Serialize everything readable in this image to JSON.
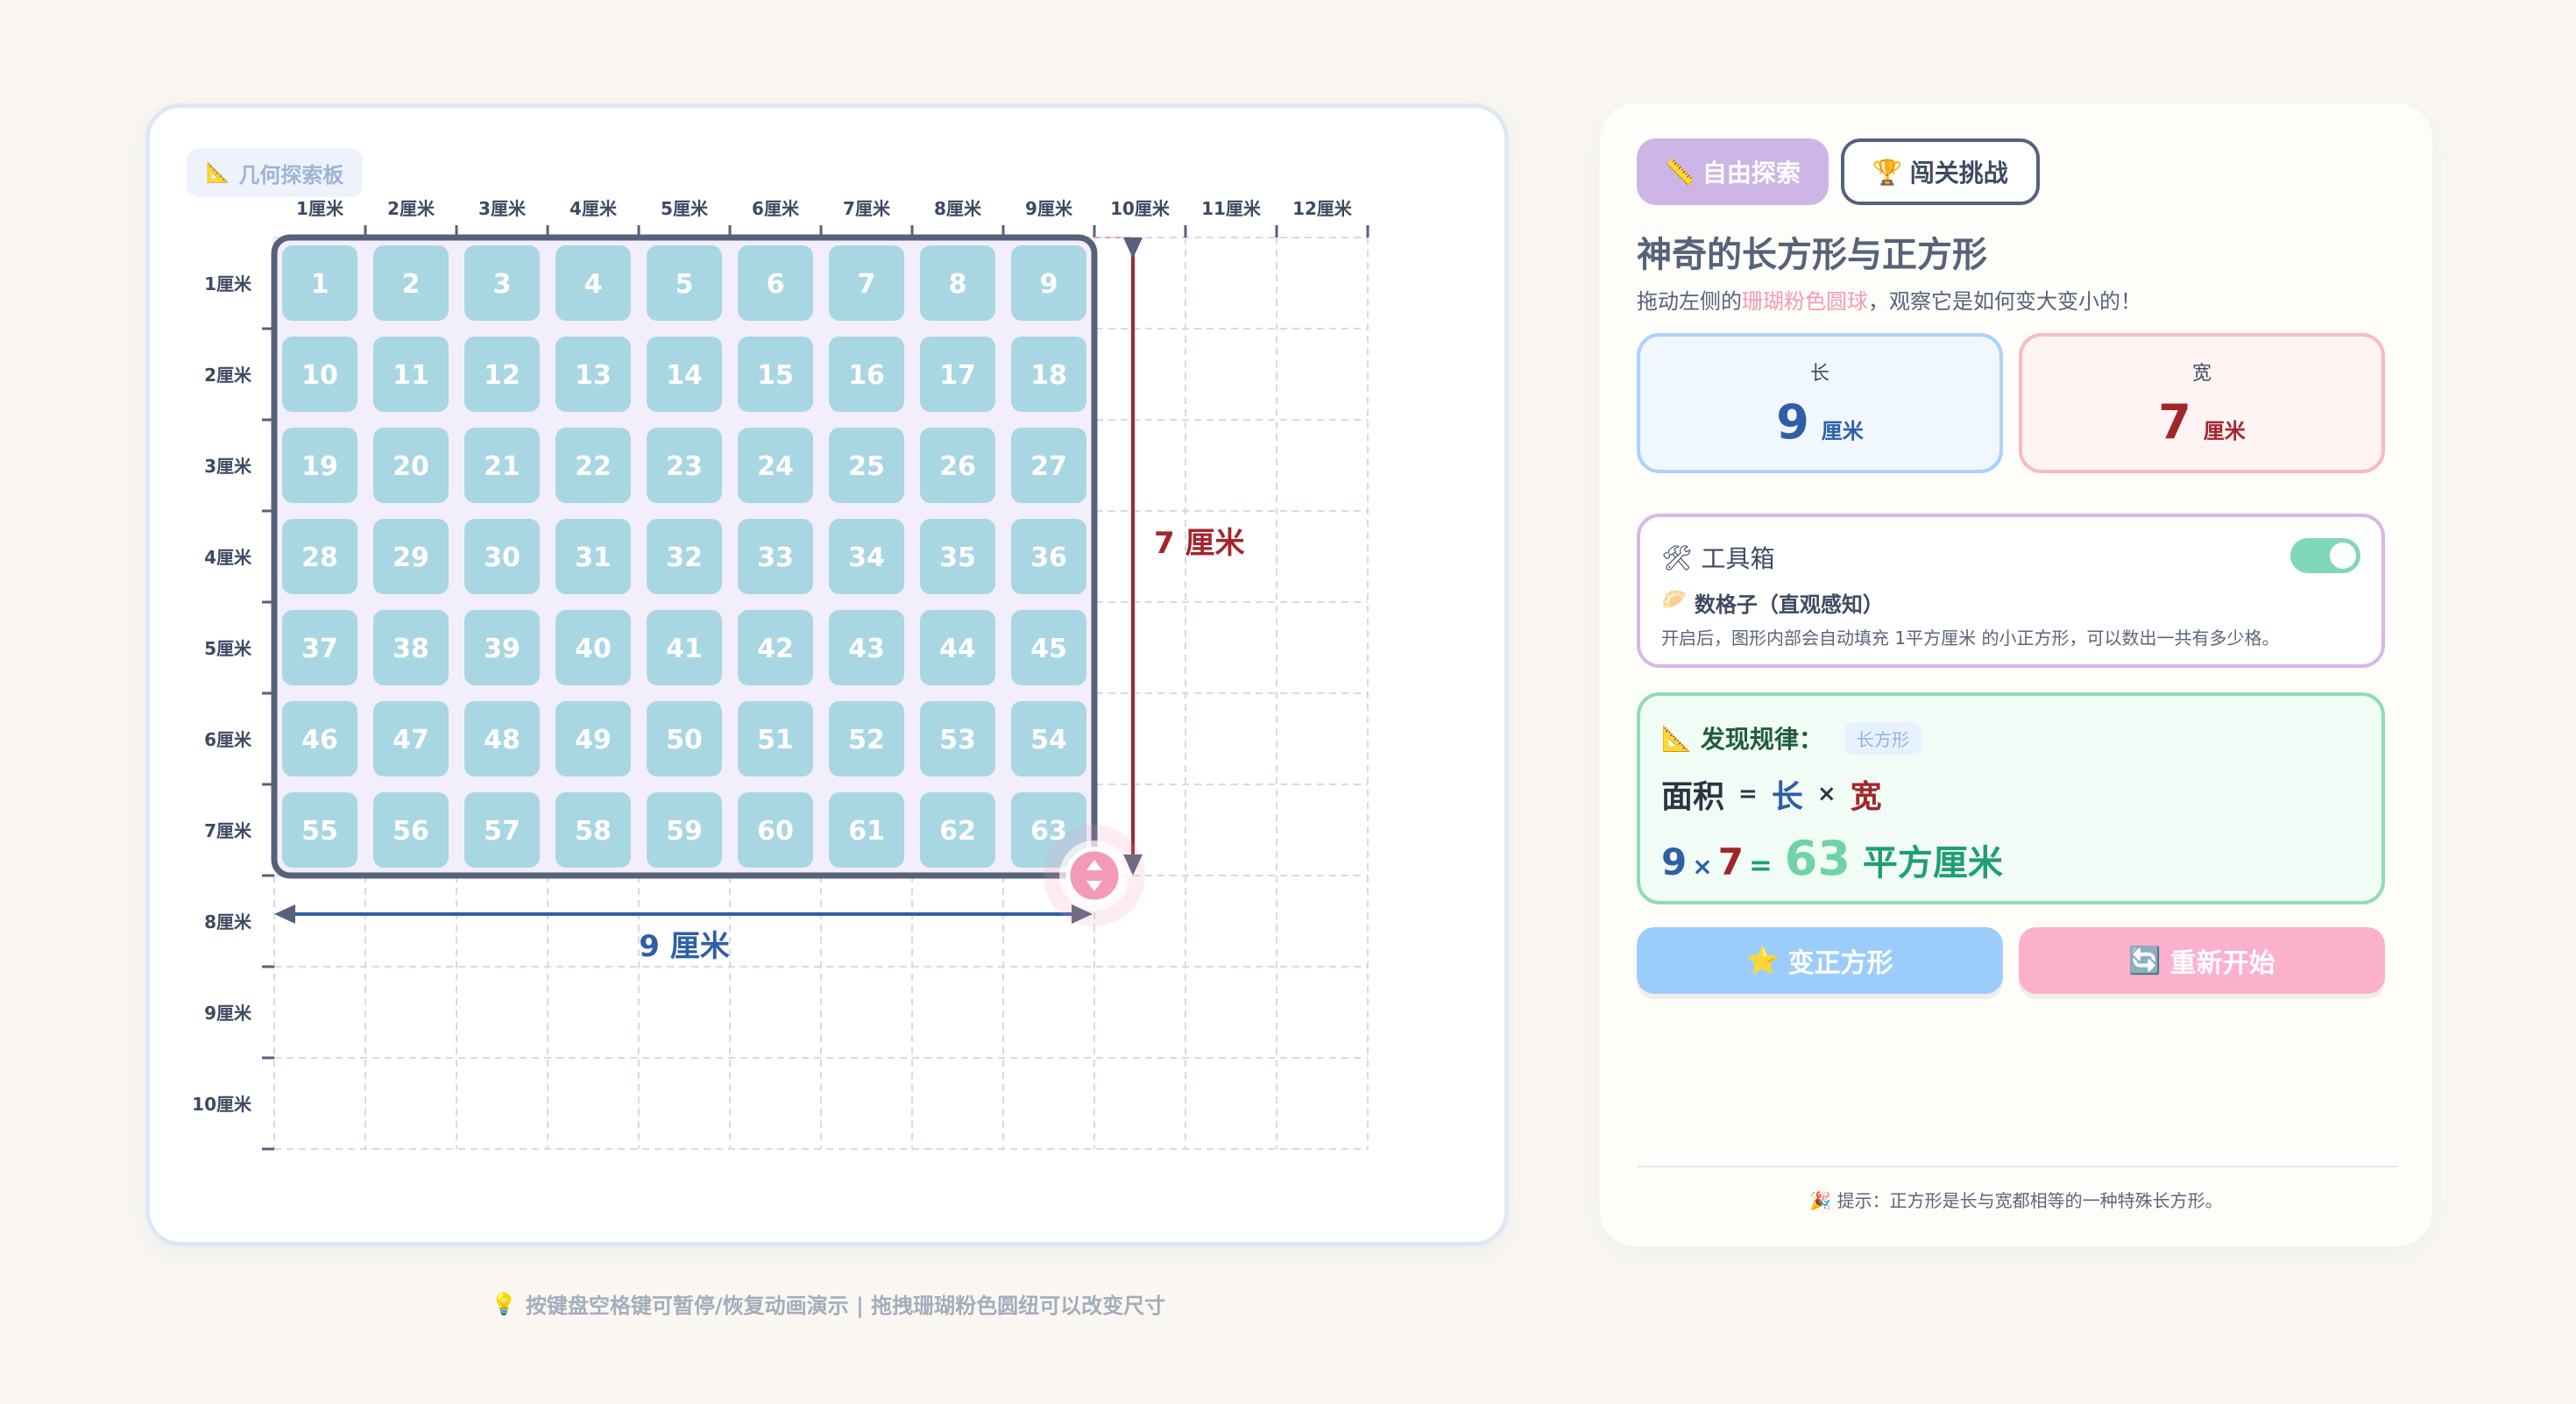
{
  "board": {
    "tag_label": "几何探索板",
    "unit": "厘米",
    "columns": 12,
    "rows": 10,
    "rect_length": 9,
    "rect_width": 7,
    "length_label": "9 厘米",
    "width_label": "7 厘米",
    "x_ticks": [
      "1厘米",
      "2厘米",
      "3厘米",
      "4厘米",
      "5厘米",
      "6厘米",
      "7厘米",
      "8厘米",
      "9厘米",
      "10厘米",
      "11厘米",
      "12厘米"
    ],
    "y_ticks": [
      "1厘米",
      "2厘米",
      "3厘米",
      "4厘米",
      "5厘米",
      "6厘米",
      "7厘米",
      "8厘米",
      "9厘米",
      "10厘米"
    ]
  },
  "hint_bottom": "按键盘空格键可暂停/恢复动画演示 | 拖拽珊瑚粉色圆纽可以改变尺寸",
  "tabs": [
    {
      "label": "自由探索",
      "icon": "ruler-icon"
    },
    {
      "label": "闯关挑战",
      "icon": "trophy-icon"
    }
  ],
  "panel": {
    "title": "神奇的长方形与正方形",
    "subtitle_before": "拖动左侧的",
    "subtitle_highlight": "珊瑚粉色圆球",
    "subtitle_after": "，观察它是如何变大变小的！"
  },
  "length_card": {
    "label": "长",
    "value": "9",
    "unit": "厘米"
  },
  "width_card": {
    "label": "宽",
    "value": "7",
    "unit": "厘米"
  },
  "toolbox": {
    "title": "工具箱",
    "option": "数格子（直观感知）",
    "description": "开启后，图形内部会自动填充 1平方厘米 的小正方形，可以数出一共有多少格。",
    "enabled": true
  },
  "rule": {
    "title": "发现规律：",
    "chip": "长方形",
    "formula_area": "面积",
    "formula_eq": "=",
    "formula_len": "长",
    "formula_times": "×",
    "formula_wid": "宽",
    "calc_len": "9",
    "calc_times": "×",
    "calc_wid": "7",
    "calc_eq": "=",
    "calc_result": "63",
    "calc_unit": "平方厘米"
  },
  "buttons": {
    "make_square": "变正方形",
    "reset": "重新开始"
  },
  "tip": "提示：正方形是长与宽都相等的一种特殊长方形。",
  "colors": {
    "width_blue": "#2e5fa6",
    "height_red": "#a1262c",
    "handle_pink": "#f39ab7",
    "result_green": "#6fd3a6"
  }
}
